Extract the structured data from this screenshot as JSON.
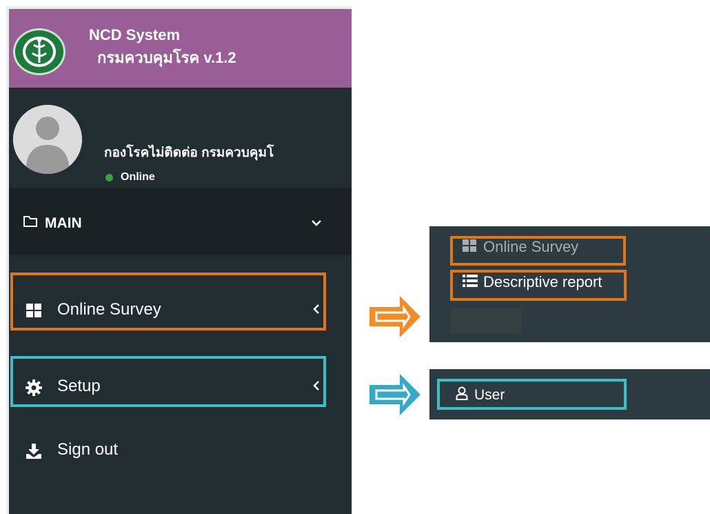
{
  "brand": {
    "title": "NCD System",
    "subtitle": "กรมควบคุมโรค v.1.2",
    "logo_icon": "dept-seal-logo",
    "color": "#9a5e97"
  },
  "user": {
    "name": "กองโรคไม่ติดต่อ กรมควบคุมโ",
    "status": "Online",
    "status_color": "#39a04a"
  },
  "sidebar": {
    "main_header": "MAIN",
    "items": [
      {
        "label": "Online Survey",
        "icon": "grid-icon"
      },
      {
        "label": "Setup",
        "icon": "gear-icon"
      },
      {
        "label": "Sign out",
        "icon": "download-icon"
      }
    ]
  },
  "submenus": {
    "online_survey": {
      "items": [
        {
          "label": "Online Survey",
          "icon": "grid-icon"
        },
        {
          "label": "Descriptive report",
          "icon": "list-icon"
        }
      ]
    },
    "setup": {
      "items": [
        {
          "label": "User",
          "icon": "user-icon"
        }
      ]
    }
  },
  "colors": {
    "sidebar_bg": "#222d32",
    "highlight_orange": "#e5750f",
    "highlight_teal": "#3bbfc9"
  }
}
